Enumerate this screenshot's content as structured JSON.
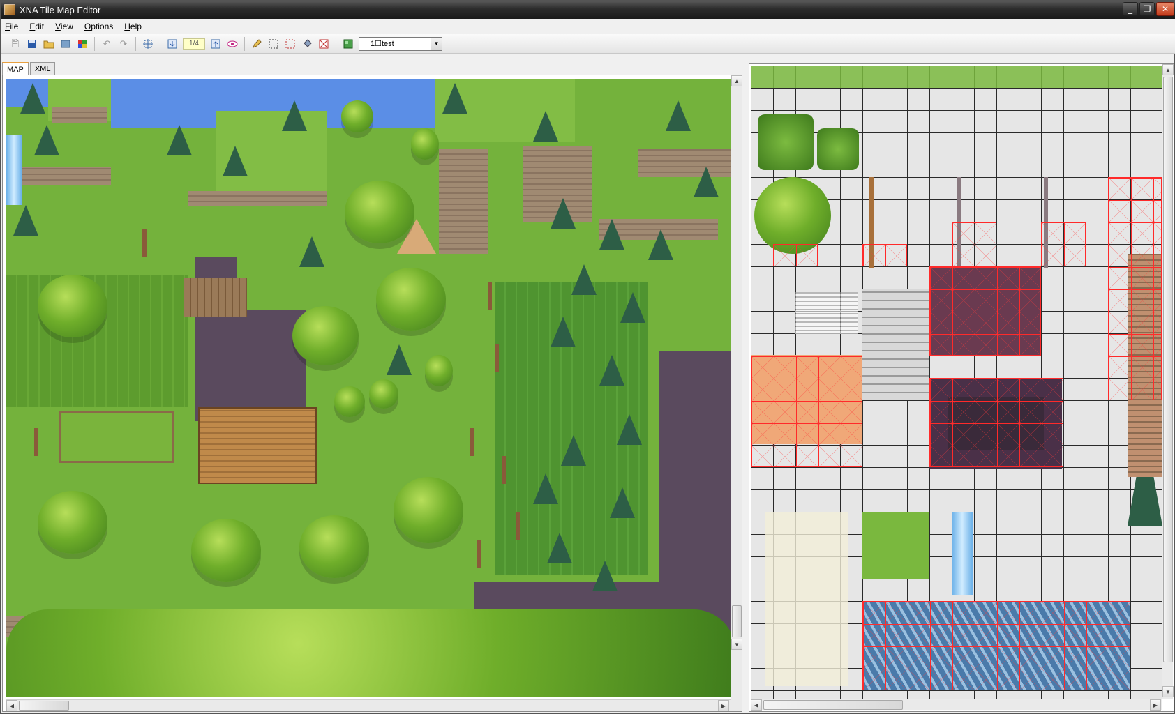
{
  "window": {
    "title": "XNA Tile Map Editor",
    "minimize_glyph": "_",
    "maximize_glyph": "❐",
    "close_glyph": "✕"
  },
  "menu": [
    "File",
    "Edit",
    "View",
    "Options",
    "Help"
  ],
  "toolbar": {
    "icons": [
      "new-file-icon",
      "save-icon",
      "open-folder-icon",
      "import-icon",
      "palette-icon",
      "undo-icon",
      "redo-icon",
      "resize-map-icon",
      "layer-down-icon",
      "layer-up-icon",
      "eye-icon",
      "pencil-icon",
      "select-icon",
      "select-area-icon",
      "fill-bucket-icon",
      "erase-icon",
      "tileset-icon"
    ],
    "layer_indicator": "1/4",
    "layer_combo_value": "1☐test"
  },
  "tabs": [
    "MAP",
    "XML"
  ],
  "active_tab": "MAP",
  "colors": {
    "grass": "#74b23c",
    "water": "#5b8ee6",
    "swamp": "#5a4a5e",
    "selection": "#ff2a2a"
  }
}
